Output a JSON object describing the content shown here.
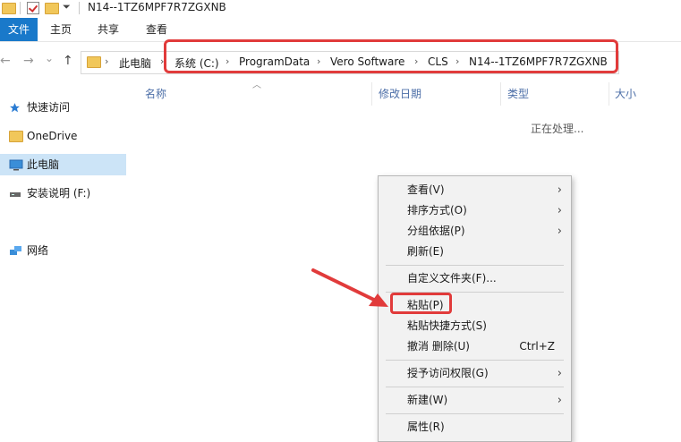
{
  "window": {
    "title": "N14--1TZ6MPF7R7ZGXNB"
  },
  "ribbon": {
    "tabs": [
      "文件",
      "主页",
      "共享",
      "查看"
    ]
  },
  "nav": {
    "back": "←",
    "forward": "→",
    "dropdown": "⌄",
    "up": "↑"
  },
  "address": {
    "crumbs": [
      "此电脑",
      "系统 (C:)",
      "ProgramData",
      "Vero Software",
      "CLS",
      "N14--1TZ6MPF7R7ZGXNB"
    ],
    "separator": "›"
  },
  "columns": {
    "name": "名称",
    "date": "修改日期",
    "type": "类型",
    "size": "大小"
  },
  "sidebar": {
    "items": [
      {
        "label": "快速访问",
        "icon": "star-icon"
      },
      {
        "label": "OneDrive",
        "icon": "folder-icon"
      },
      {
        "label": "此电脑",
        "icon": "computer-icon"
      },
      {
        "label": "安装说明 (F:)",
        "icon": "drive-icon"
      },
      {
        "label": "网络",
        "icon": "network-icon"
      }
    ]
  },
  "status": {
    "processing": "正在处理..."
  },
  "context_menu": {
    "items": [
      {
        "label": "查看(V)",
        "submenu": "›"
      },
      {
        "label": "排序方式(O)",
        "submenu": "›"
      },
      {
        "label": "分组依据(P)",
        "submenu": "›"
      },
      {
        "label": "刷新(E)"
      },
      {
        "label": "自定义文件夹(F)..."
      },
      {
        "label": "粘贴(P)"
      },
      {
        "label": "粘贴快捷方式(S)"
      },
      {
        "label": "撤消 删除(U)",
        "shortcut": "Ctrl+Z"
      },
      {
        "label": "授予访问权限(G)",
        "submenu": "›"
      },
      {
        "label": "新建(W)",
        "submenu": "›"
      },
      {
        "label": "属性(R)"
      }
    ]
  },
  "colors": {
    "accent": "#1979ca",
    "highlight_red": "#e13b3b",
    "selected": "#cce4f7"
  }
}
